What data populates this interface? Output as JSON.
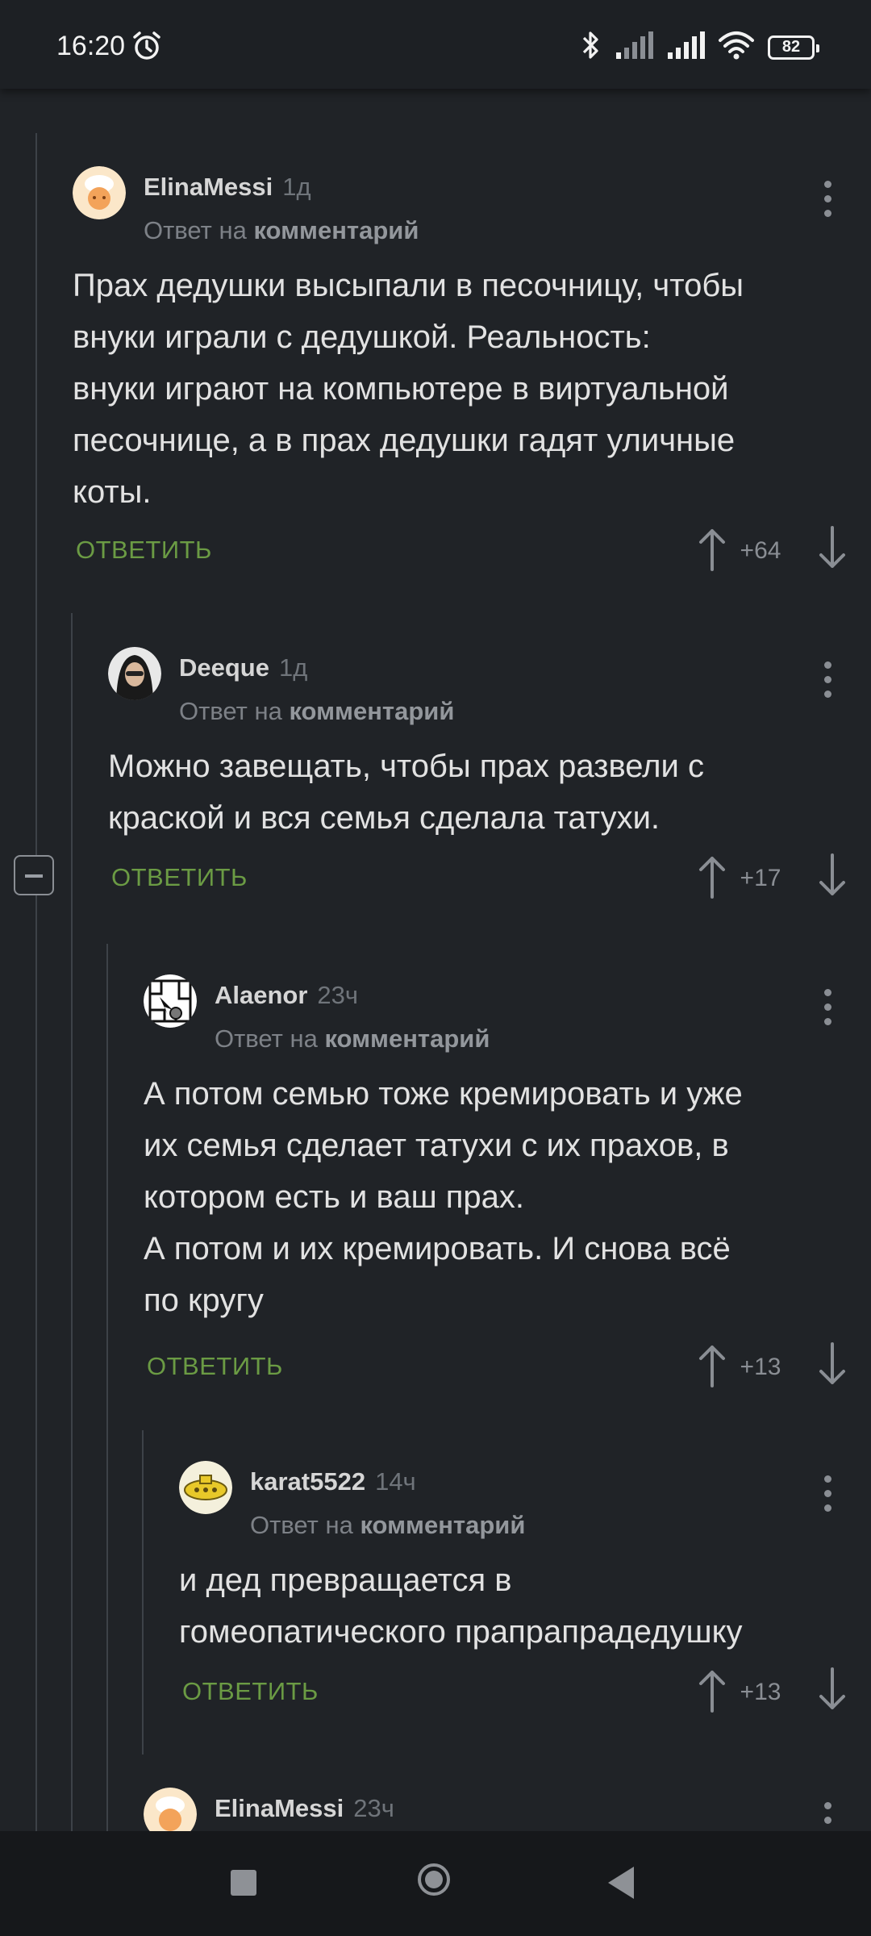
{
  "status_bar": {
    "time": "16:20",
    "battery": "82",
    "icons": [
      "alarm-icon",
      "bluetooth-icon",
      "signal-icon",
      "signal-icon",
      "wifi-icon",
      "battery-icon"
    ]
  },
  "ui": {
    "reply_prefix": "Ответ на",
    "reply_link": "комментарий",
    "reply_button": "ОТВЕТИТЬ"
  },
  "comments": [
    {
      "author": "ElinaMessi",
      "time": "1д",
      "text": [
        "Прах дедушки высыпали в песочницу, чтобы",
        "внуки играли с дедушкой. Реальность:",
        "внуки играют на компьютере в виртуальной",
        "песочнице, а в прах дедушки гадят уличные",
        "коты."
      ],
      "score": "+64"
    },
    {
      "author": "Deeque",
      "time": "1д",
      "text": [
        "Можно завещать, чтобы прах развели с",
        "краской и вся семья сделала татухи."
      ],
      "score": "+17"
    },
    {
      "author": "Alaenor",
      "time": "23ч",
      "text": [
        "А потом семью тоже кремировать и уже",
        "их семья сделает татухи с их прахов, в",
        "котором есть и ваш прах.",
        "А потом и их кремировать. И снова всё",
        "по кругу"
      ],
      "score": "+13"
    },
    {
      "author": "karat5522",
      "time": "14ч",
      "text": [
        "и дед превращается в",
        "гомеопатического прапрапрадедушку"
      ],
      "score": "+13"
    },
    {
      "author": "ElinaMessi",
      "time": "23ч"
    }
  ],
  "colors": {
    "background": "#202327",
    "reply_green": "#6b9b44",
    "text": "#e2e2e2",
    "muted": "#7d8187"
  }
}
